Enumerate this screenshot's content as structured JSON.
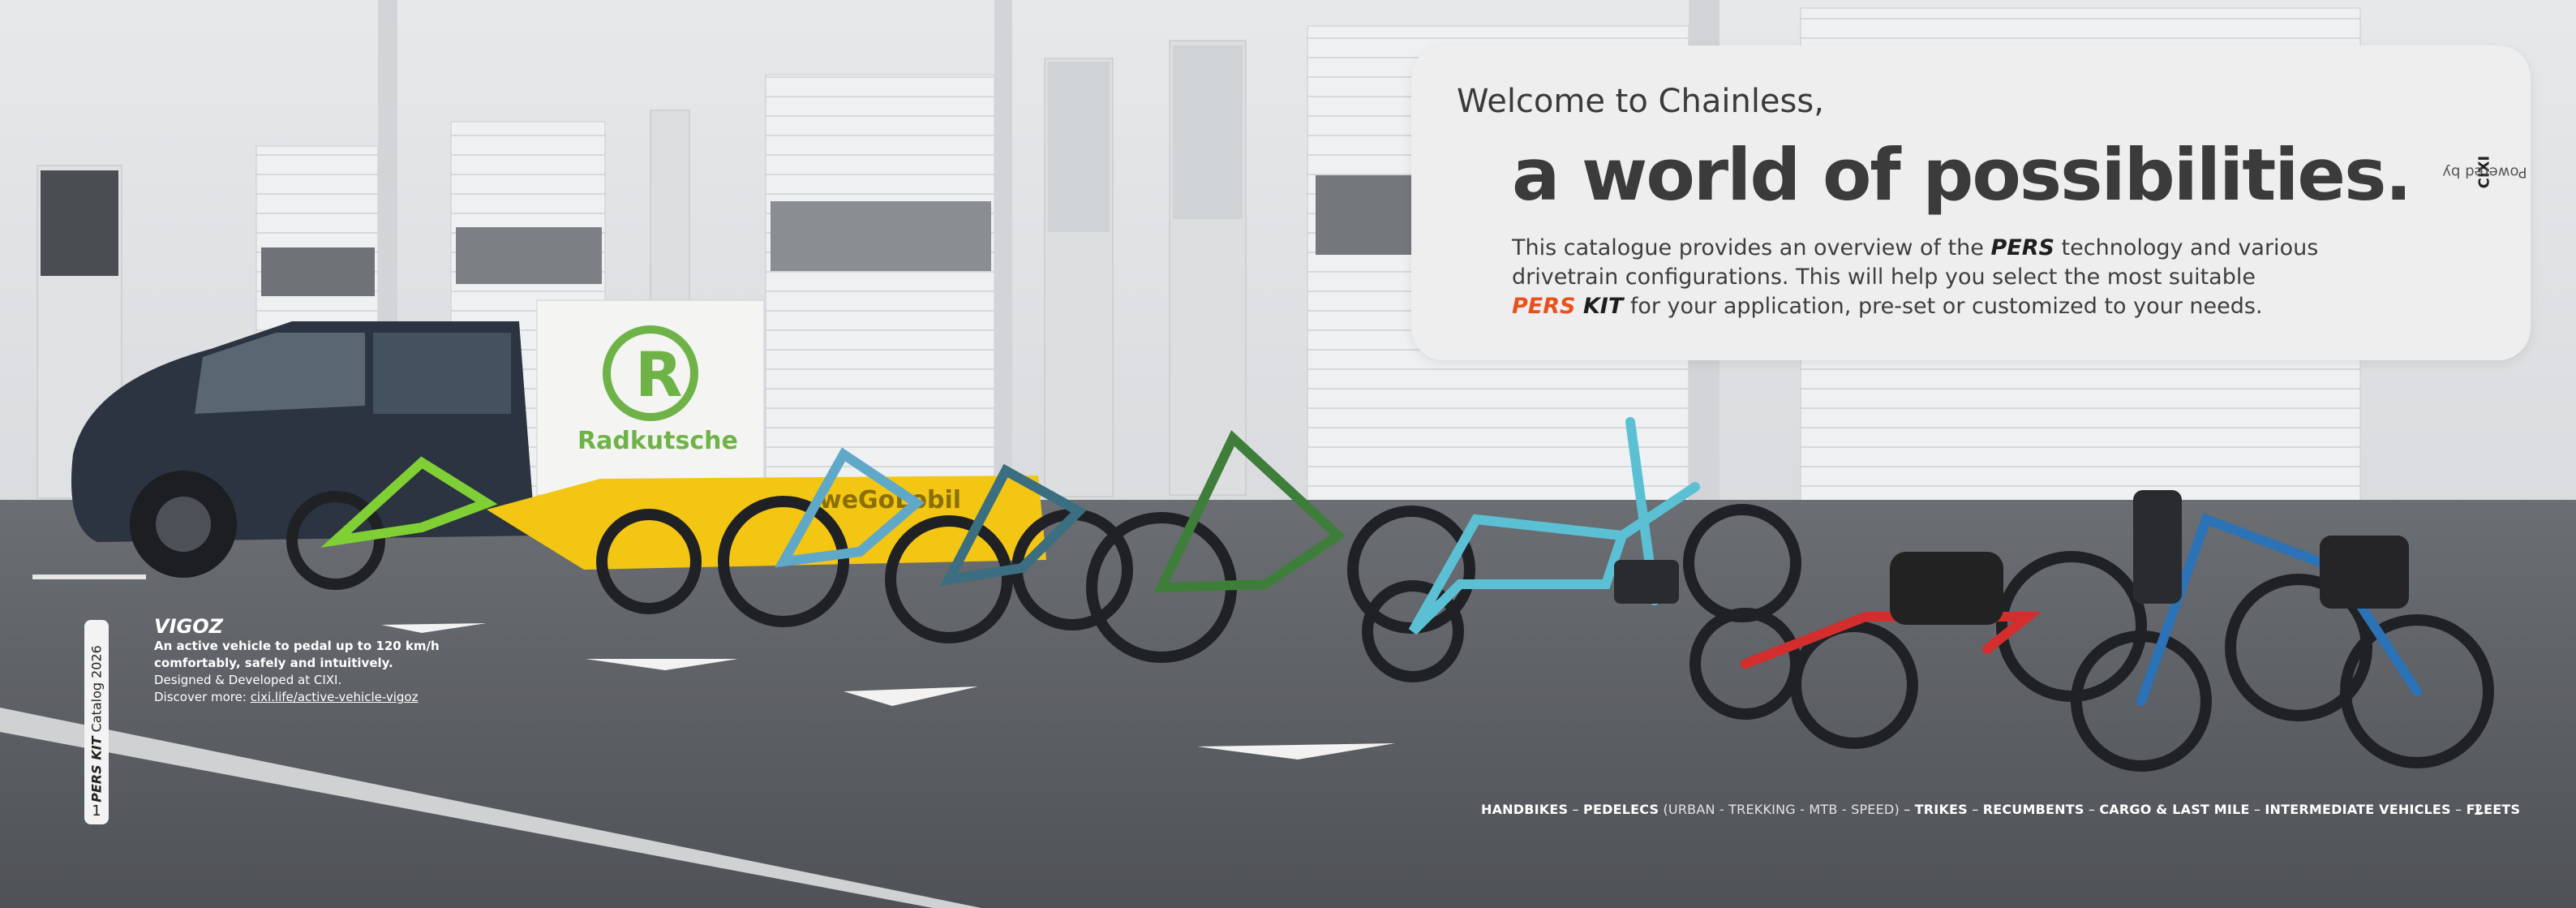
{
  "card": {
    "welcome": "Welcome to Chainless,",
    "headline": "a world of possibilities.",
    "intro": {
      "p1": "This catalogue provides an overview of the ",
      "brand1": "PERS",
      "p2": " technology and various drivetrain configurations. This will help you select the most suitable ",
      "kit_orange": "PERS",
      "kit_dark": " KIT",
      "p3": " for your application, pre-set or customized to your needs."
    },
    "powered_prefix": "Powered by ",
    "powered_brand": "CIXI"
  },
  "side_tab": {
    "brand": "PERS KIT",
    "catalog": " Catalog 2026",
    "page": "1"
  },
  "caption": {
    "title": "VIGOZ",
    "line1": "An active vehicle to pedal up to 120 km/h",
    "line2": "comfortably, safely and intuitively.",
    "line3": "Designed & Developed at CIXI.",
    "line4_prefix": "Discover more: ",
    "line4_link": "cixi.life/active-vehicle-vigoz"
  },
  "footer": {
    "handbikes": "HANDBIKES",
    "sep": " – ",
    "pedelecs": "PEDELECS",
    "pedelecs_sub": " (URBAN - TREKKING - MTB - SPEED)",
    "trikes": "TRIKES",
    "recumbents": "RECUMBENTS",
    "cargo": "CARGO & LAST MILE",
    "intermediate": "INTERMEDIATE VEHICLES",
    "fleets": "FLEETS",
    "page": "2"
  },
  "photo": {
    "sign_text": "Radkutsche",
    "trailer_text": "weGoLobil"
  },
  "colors": {
    "accent": "#e8511d",
    "card_bg": "#eeeeee",
    "text_dark": "#3b3b3b"
  }
}
